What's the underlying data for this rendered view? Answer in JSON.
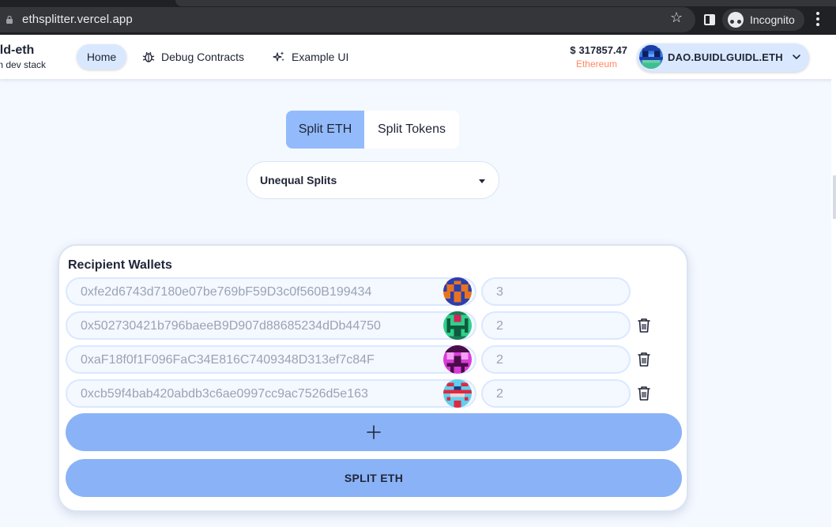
{
  "browser": {
    "url": "ethsplitter.vercel.app",
    "incognito_label": "Incognito",
    "icons": [
      "lock-icon",
      "star-icon",
      "side-panel-icon",
      "incognito-icon",
      "menu-kebab-icon"
    ]
  },
  "header": {
    "brand_title": "old-eth",
    "brand_subtitle": "m dev stack",
    "nav": {
      "home": "Home",
      "debug": "Debug Contracts",
      "example": "Example UI"
    },
    "balance": {
      "currency": "$",
      "amount": "317857.47",
      "network": "Ethereum"
    },
    "account": {
      "name": "DAO.BUIDLGUIDL.ETH"
    }
  },
  "toggle": {
    "active": "Split ETH",
    "inactive": "Split Tokens"
  },
  "select": {
    "value": "Unequal Splits"
  },
  "card": {
    "title": "Recipient Wallets",
    "rows": [
      {
        "address": "0xfe2d6743d7180e07be769bF59D3c0f560B199434",
        "amount": "3",
        "removable": false
      },
      {
        "address": "0x502730421b796baeeB9D907d88685234dDb44750",
        "amount": "2",
        "removable": true
      },
      {
        "address": "0xaF18f0f1F096FaC34E816C7409348D313ef7c84F",
        "amount": "2",
        "removable": true
      },
      {
        "address": "0xcb59f4bab420abdb3c6ae0997cc9ac7526d5e163",
        "amount": "2",
        "removable": true
      }
    ],
    "split_button": "SPLIT ETH"
  },
  "colors": {
    "accent": "#93bbfb",
    "button": "#8ab2f7",
    "network": "#ff8863",
    "background": "#f4f8ff"
  }
}
